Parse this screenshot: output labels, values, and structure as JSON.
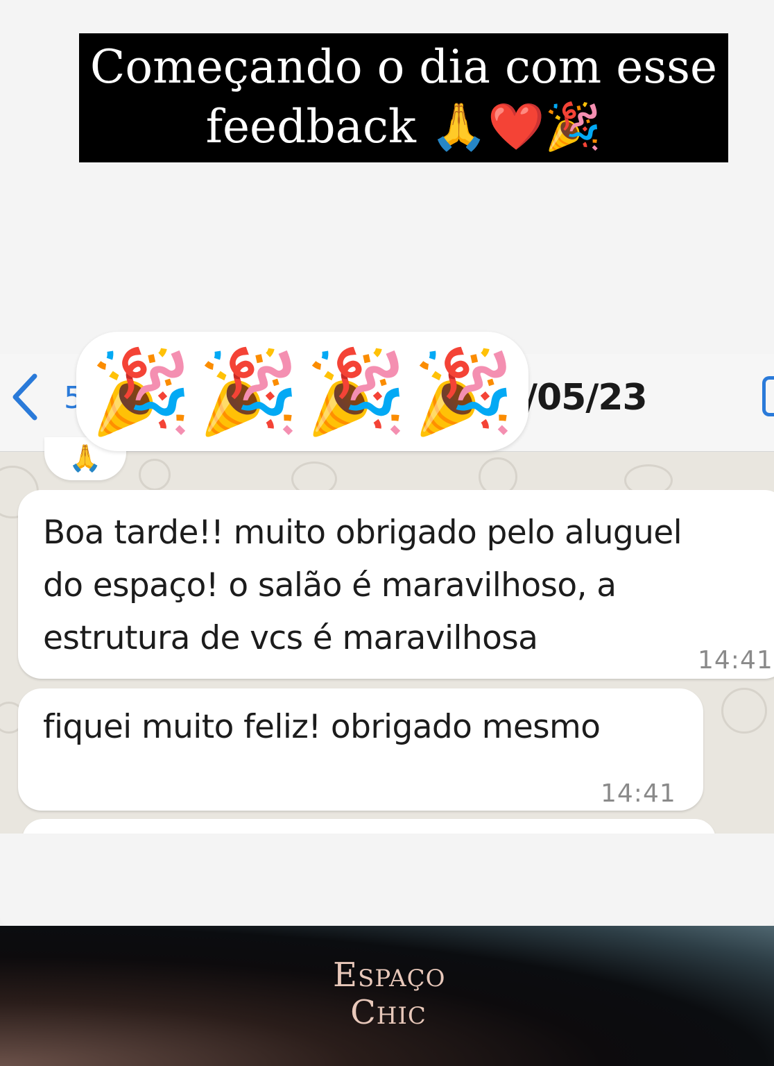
{
  "caption": {
    "line1": "Começando o dia com esse",
    "line2": "feedback 🙏❤️🎉"
  },
  "chat_header": {
    "contact_fragment": "5",
    "date": "/05/23"
  },
  "reaction": {
    "emojis": [
      "🎉",
      "🎉",
      "🎉",
      "🎉"
    ],
    "pray": "🙏"
  },
  "messages": [
    {
      "lines": [
        "Boa tarde!! muito obrigado pelo aluguel",
        "do espaço! o salão é maravilhoso, a",
        "estrutura de vcs é maravilhosa"
      ],
      "time": "14:41"
    },
    {
      "lines": [
        "fiquei muito feliz! obrigado mesmo"
      ],
      "time": "14:41"
    }
  ],
  "brand": {
    "line1": "Espaço",
    "line2": "Chic",
    "color": "#e8c8ba"
  },
  "icons": {
    "back": "chevron-left-icon",
    "call": "call-icon"
  }
}
